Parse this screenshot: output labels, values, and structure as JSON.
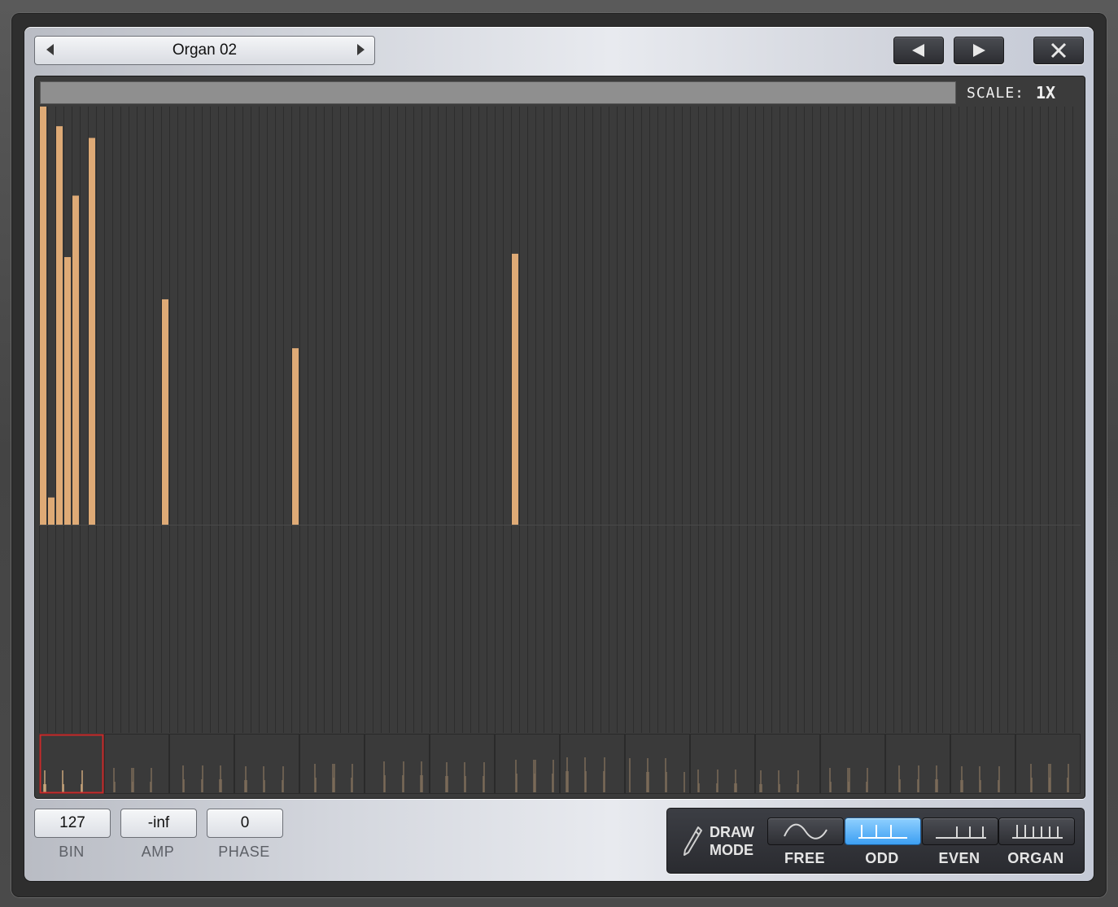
{
  "preset": {
    "name": "Organ 02"
  },
  "scale": {
    "label": "SCALE:",
    "value": "1X"
  },
  "fields": [
    {
      "value": "127",
      "label": "BIN"
    },
    {
      "value": "-inf",
      "label": "AMP"
    },
    {
      "value": "0",
      "label": "PHASE"
    }
  ],
  "draw_mode": {
    "title_line1": "DRAW",
    "title_line2": "MODE",
    "modes": [
      "FREE",
      "ODD",
      "EVEN",
      "ORGAN"
    ],
    "active": "ODD"
  },
  "harmonics": {
    "bin_count": 128,
    "amplitudes": [
      {
        "bin": 1,
        "level": 1.0
      },
      {
        "bin": 2,
        "level": 0.065
      },
      {
        "bin": 3,
        "level": 0.953
      },
      {
        "bin": 4,
        "level": 0.64
      },
      {
        "bin": 5,
        "level": 0.787
      },
      {
        "bin": 7,
        "level": 0.925
      },
      {
        "bin": 16,
        "level": 0.539
      },
      {
        "bin": 32,
        "level": 0.422
      },
      {
        "bin": 59,
        "level": 0.648
      }
    ]
  },
  "colors": {
    "bar": "#deaa76",
    "grid_bg": "#3b3b3b",
    "grid_line": "#2d2d2d",
    "selection": "#c92a2a",
    "active_mode": "#4aa6f5"
  }
}
